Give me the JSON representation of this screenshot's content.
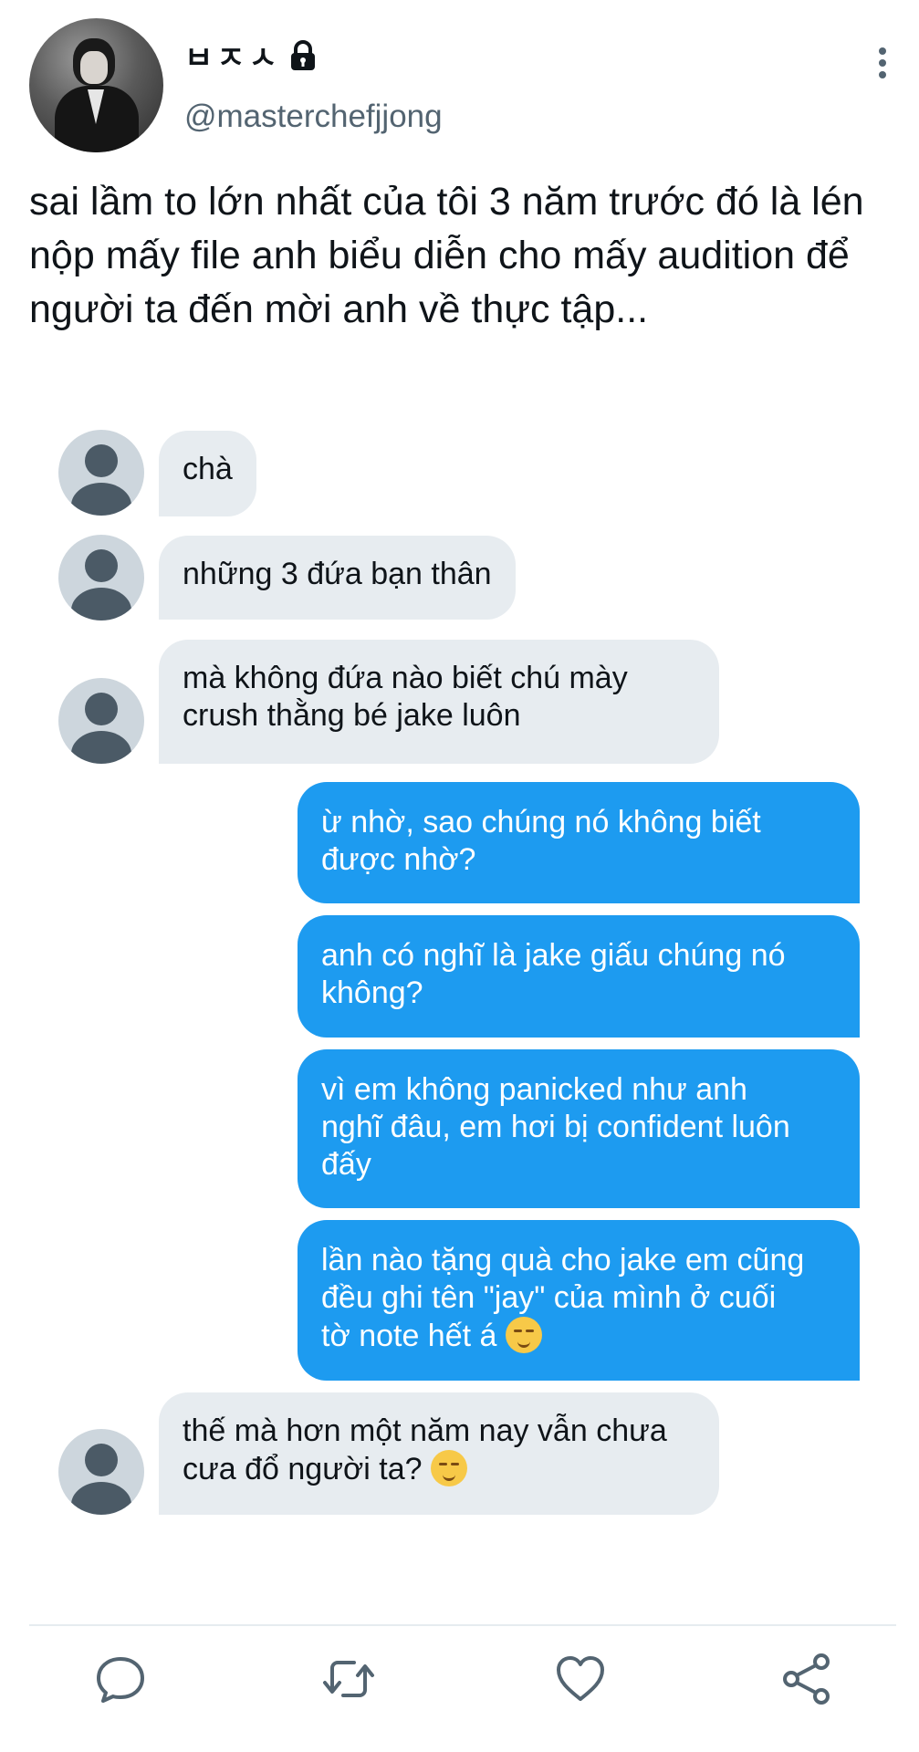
{
  "tweet": {
    "display_name": "ㅂㅈㅅ",
    "handle": "@masterchefjjong",
    "text": "sai lầm to lớn nhất của tôi 3 năm trước đó là lén nộp mấy file anh biểu diễn cho mấy audition để người ta đến mời anh về thực tập..."
  },
  "icons": {
    "lock": "lock-icon",
    "more": "more-vertical-icon",
    "reply": "reply-icon",
    "retweet": "retweet-icon",
    "like": "heart-icon",
    "share": "share-icon"
  },
  "chat": {
    "messages": [
      {
        "side": "in",
        "text": "chà"
      },
      {
        "side": "in",
        "text": "những 3 đứa bạn thân"
      },
      {
        "side": "in",
        "line1": "mà không đứa nào biết chú mày",
        "line2": "crush thằng bé jake luôn"
      },
      {
        "side": "out",
        "line1": "ừ nhờ, sao chúng nó không biết",
        "line2": "được nhờ?"
      },
      {
        "side": "out",
        "line1": "anh có nghĩ là jake giấu chúng nó",
        "line2": "không?"
      },
      {
        "side": "out",
        "line1": "vì em không panicked như anh",
        "line2": "nghĩ đâu, em hơi bị confident luôn",
        "line3": "đấy"
      },
      {
        "side": "out",
        "line1": "lần nào tặng quà cho jake em cũng",
        "line2": "đều ghi tên \"jay\" của mình ở cuối",
        "line3": "tờ note hết á",
        "emoji": "relieved-face-emoji"
      },
      {
        "side": "in",
        "line1": "thế mà hơn một năm nay vẫn chưa",
        "line2": "cưa đổ người ta?",
        "emoji": "raised-eyebrow-face-emoji"
      }
    ]
  },
  "colors": {
    "incoming_bubble": "#e7ecf0",
    "outgoing_bubble": "#1d9bf0",
    "secondary_text": "#536471"
  }
}
